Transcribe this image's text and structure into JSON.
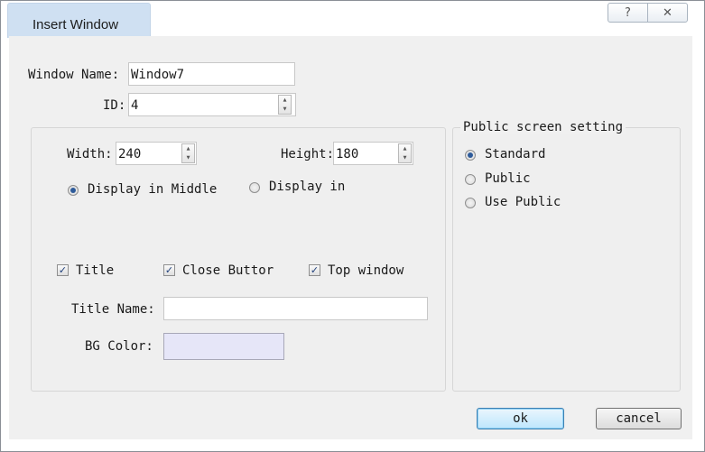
{
  "window": {
    "title": "Insert Window",
    "help_glyph": "?",
    "close_glyph": "✕"
  },
  "form": {
    "window_name_label": "Window Name:",
    "window_name_value": "Window7",
    "id_label": "ID:",
    "id_value": "4",
    "width_label": "Width:",
    "width_value": "240",
    "height_label": "Height:",
    "height_value": "180",
    "display_middle_label": "Display in Middle",
    "display_in_label": "Display in",
    "title_check_label": "Title",
    "close_button_check_label": "Close Buttor",
    "top_window_check_label": "Top window",
    "title_name_label": "Title Name:",
    "title_name_value": "",
    "bg_color_label": "BG Color:",
    "bg_color_value": "#e6e6f8"
  },
  "public_screen": {
    "legend": "Public screen setting",
    "options": [
      "Standard",
      "Public",
      "Use Public"
    ],
    "selected": "Standard"
  },
  "buttons": {
    "ok": "ok",
    "cancel": "cancel"
  },
  "icons": {
    "help": "question-mark-icon",
    "close": "close-x-icon",
    "spinner": "spin-up-down-icon",
    "check": "checkmark-icon"
  }
}
